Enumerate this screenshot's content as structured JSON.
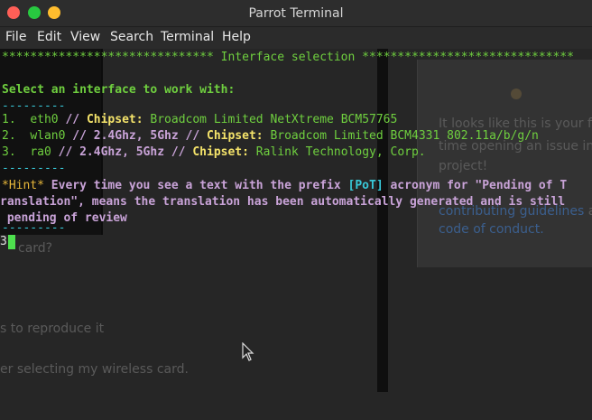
{
  "window": {
    "title": "Parrot Terminal"
  },
  "menu": [
    "File",
    "Edit",
    "View",
    "Search",
    "Terminal",
    "Help"
  ],
  "terminal": {
    "header": "****************************** Interface selection ******************************",
    "prompt": "Select an interface to work with:",
    "separator": "---------",
    "interfaces": [
      {
        "num": "1.",
        "name": "eth0",
        "bands": "",
        "chipset_label": "Chipset:",
        "chipset": "Broadcom Limited NetXtreme BCM57765"
      },
      {
        "num": "2.",
        "name": "wlan0",
        "bands": "2.4Ghz, 5Ghz",
        "chipset_label": "Chipset:",
        "chipset": "Broadcom Limited BCM4331 802.11a/b/g/n"
      },
      {
        "num": "3.",
        "name": "ra0",
        "bands": "2.4Ghz, 5Ghz",
        "chipset_label": "Chipset:",
        "chipset": "Ralink Technology, Corp."
      }
    ],
    "hint_tag": "*Hint*",
    "hint_text_1": " Every time you see a text with the prefix ",
    "hint_pot": "[PoT]",
    "hint_text_2": " acronym for \"Pending of T",
    "hint_line2": "ranslation\", means the translation has been automatically generated and is still",
    "hint_line3": " pending of review",
    "input_value": "3"
  },
  "background": {
    "fragment_1": "card?",
    "fragment_2": "s to reproduce it",
    "fragment_3": "er selecting my wireless card.",
    "panel_line_1": "It looks like this is your fi",
    "panel_line_2": "time opening an issue in",
    "panel_line_3": "project!",
    "panel_link_1": "contributing guidelines",
    "panel_text_4": " a",
    "panel_link_2": "code of conduct."
  }
}
